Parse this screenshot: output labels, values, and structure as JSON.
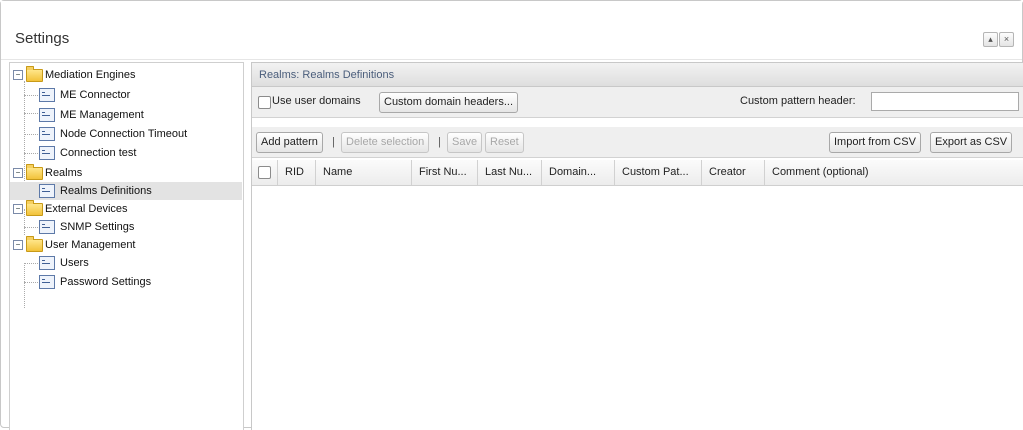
{
  "window": {
    "title": "Settings",
    "buttons": [
      "▴",
      "×"
    ]
  },
  "tree": {
    "nodes": [
      {
        "label": "Mediation Engines",
        "type": "folder",
        "expanded": true,
        "icon": "folder-icon"
      },
      {
        "label": "ME Connector",
        "type": "page",
        "icon": "document-icon"
      },
      {
        "label": "ME Management",
        "type": "page",
        "icon": "document-icon"
      },
      {
        "label": "Node Connection Timeout",
        "type": "page",
        "icon": "document-icon"
      },
      {
        "label": "Connection test",
        "type": "page",
        "icon": "document-icon"
      },
      {
        "label": "Realms",
        "type": "folder",
        "expanded": true,
        "icon": "folder-icon"
      },
      {
        "label": "Realms Definitions",
        "type": "page",
        "selected": true,
        "icon": "document-icon"
      },
      {
        "label": "External Devices",
        "type": "folder",
        "expanded": true,
        "icon": "folder-icon"
      },
      {
        "label": "SNMP Settings",
        "type": "page",
        "icon": "document-icon"
      },
      {
        "label": "User Management",
        "type": "folder",
        "expanded": true,
        "icon": "folder-icon"
      },
      {
        "label": "Users",
        "type": "page",
        "icon": "document-icon"
      },
      {
        "label": "Password Settings",
        "type": "page",
        "icon": "document-icon"
      }
    ],
    "expander_symbol": "−"
  },
  "panel": {
    "title": "Realms: Realms Definitions",
    "use_user_domains": "Use user domains",
    "custom_domain_headers": "Custom domain headers...",
    "custom_pattern_header": "Custom pattern header:",
    "custom_pattern_value": ""
  },
  "actions": {
    "add_pattern": "Add pattern",
    "delete_selection": "Delete selection",
    "save": "Save",
    "reset": "Reset",
    "import_csv": "Import from CSV",
    "export_csv": "Export as CSV",
    "separator": "|"
  },
  "table": {
    "columns": [
      "RID",
      "Name",
      "First Nu...",
      "Last Nu...",
      "Domain...",
      "Custom Pat...",
      "Creator",
      "Comment (optional)"
    ],
    "rows": []
  },
  "colors": {
    "selected_tree_bg": "#e3e3e3",
    "panel_title": "#4a5d7b",
    "folder": "#f2c23a"
  }
}
